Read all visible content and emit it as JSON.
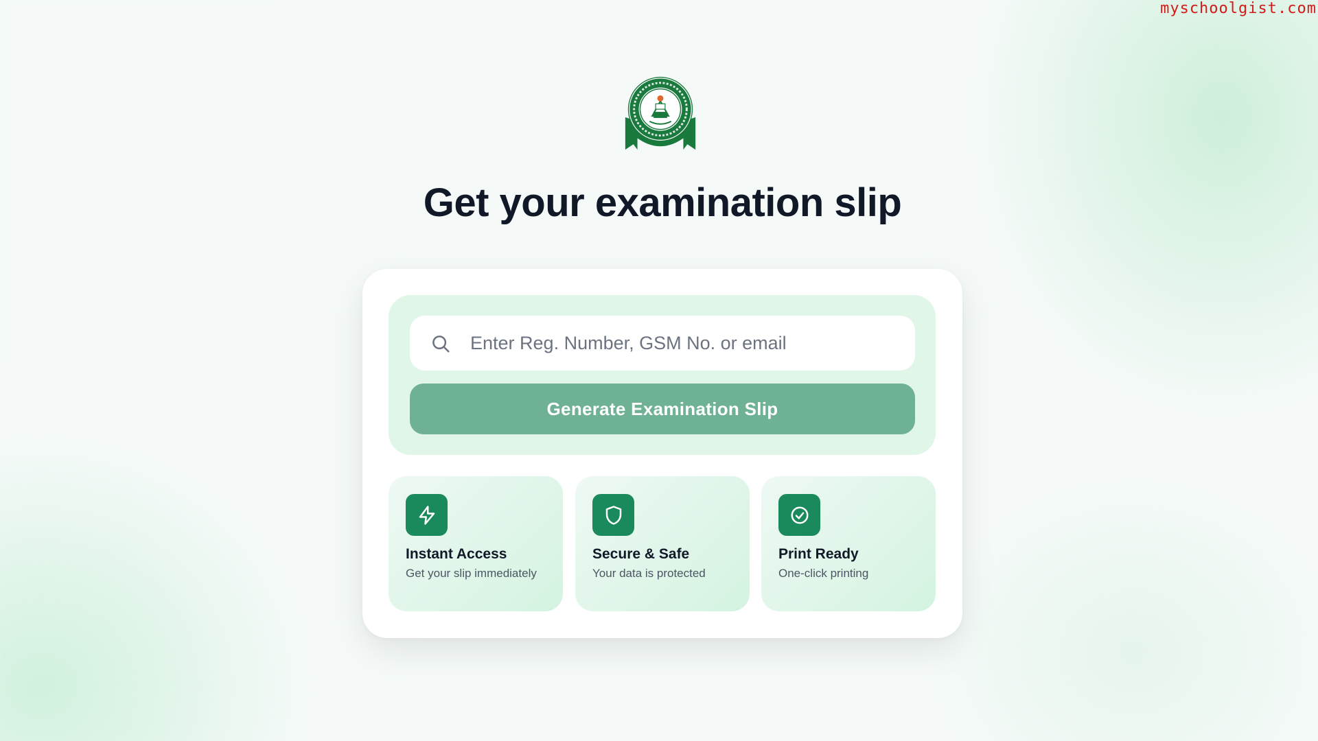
{
  "watermark": "myschoolgist.com",
  "logo": {
    "name": "jamb-crest-logo",
    "ring_text_top": "JOINT ADMISSIONS AND MATRICULATION BOARD",
    "ring_text_bottom": "SERVICE AND INTEGRITY",
    "colors": {
      "green": "#1a7a3e",
      "white": "#ffffff"
    }
  },
  "page": {
    "title": "Get your examination slip"
  },
  "search": {
    "placeholder": "Enter Reg. Number, GSM No. or email",
    "value": "",
    "icon": "search-icon"
  },
  "generate_button": {
    "label": "Generate Examination Slip"
  },
  "features": [
    {
      "icon": "lightning-icon",
      "title": "Instant Access",
      "description": "Get your slip immediately"
    },
    {
      "icon": "shield-icon",
      "title": "Secure & Safe",
      "description": "Your data is protected"
    },
    {
      "icon": "check-circle-icon",
      "title": "Print Ready",
      "description": "One-click printing"
    }
  ],
  "colors": {
    "accent": "#1a8a5c",
    "button": "#6fb194",
    "panel": "#dff6e8",
    "title_text": "#111827",
    "watermark": "#d31a1a"
  }
}
